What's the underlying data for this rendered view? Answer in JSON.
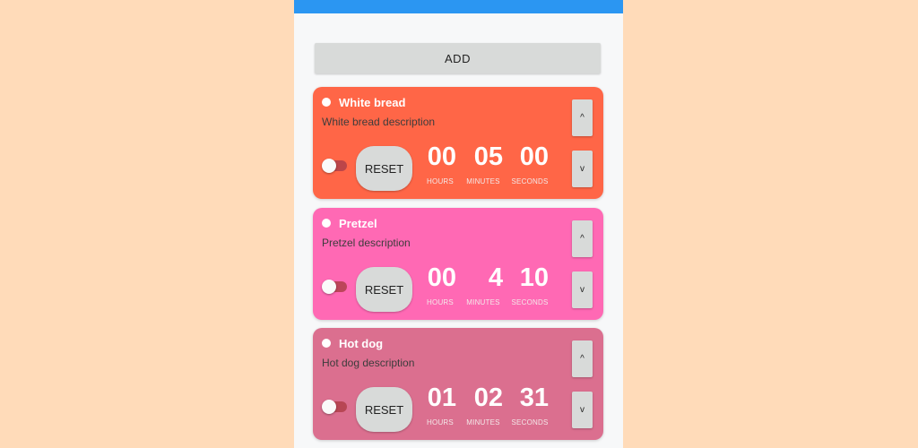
{
  "colors": {
    "background": "#ffdbb9",
    "topbar": "#2b96f2",
    "card_white_bread": "#ff6647",
    "card_pretzel": "#ff69b4",
    "card_hot_dog": "#db6f8f"
  },
  "add_button": {
    "label": "ADD"
  },
  "timers": [
    {
      "title": "White bread",
      "description": "White bread description",
      "reset_label": "RESET",
      "hours": "00",
      "minutes": "05",
      "seconds": "00",
      "hours_label": "HOURS",
      "minutes_label": "MINUTES",
      "seconds_label": "SECONDS",
      "up_label": "^",
      "down_label": "v",
      "color": "#ff6647"
    },
    {
      "title": "Pretzel",
      "description": "Pretzel description",
      "reset_label": "RESET",
      "hours": "00",
      "minutes": "4",
      "seconds": "10",
      "hours_label": "HOURS",
      "minutes_label": "MINUTES",
      "seconds_label": "SECONDS",
      "up_label": "^",
      "down_label": "v",
      "color": "#ff69b4"
    },
    {
      "title": "Hot dog",
      "description": "Hot dog description",
      "reset_label": "RESET",
      "hours": "01",
      "minutes": "02",
      "seconds": "31",
      "hours_label": "HOURS",
      "minutes_label": "MINUTES",
      "seconds_label": "SECONDS",
      "up_label": "^",
      "down_label": "v",
      "color": "#db6f8f"
    }
  ]
}
